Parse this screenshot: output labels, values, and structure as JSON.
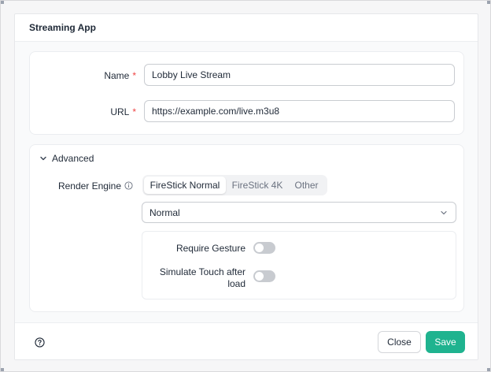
{
  "dialog": {
    "title": "Streaming App"
  },
  "form": {
    "name_label": "Name",
    "name_required": "*",
    "name_value": "Lobby Live Stream",
    "url_label": "URL",
    "url_required": "*",
    "url_value": "https://example.com/live.m3u8"
  },
  "advanced": {
    "toggle_label": "Advanced",
    "expanded": true,
    "render_engine_label": "Render Engine",
    "render_engine_options": [
      "FireStick Normal",
      "FireStick 4K",
      "Other"
    ],
    "render_engine_selected": "FireStick Normal",
    "mode_value": "Normal",
    "require_gesture_label": "Require Gesture",
    "require_gesture_on": false,
    "simulate_touch_label_line1": "Simulate Touch after",
    "simulate_touch_label_line2": "load",
    "simulate_touch_on": false
  },
  "footer": {
    "close_label": "Close",
    "save_label": "Save"
  },
  "colors": {
    "accent": "#1fb38f",
    "required": "#ef4444",
    "toggle_off": "#c8cbd0"
  },
  "icons": [
    "chevron-down-icon",
    "info-icon",
    "caret-down-icon",
    "help-icon"
  ]
}
